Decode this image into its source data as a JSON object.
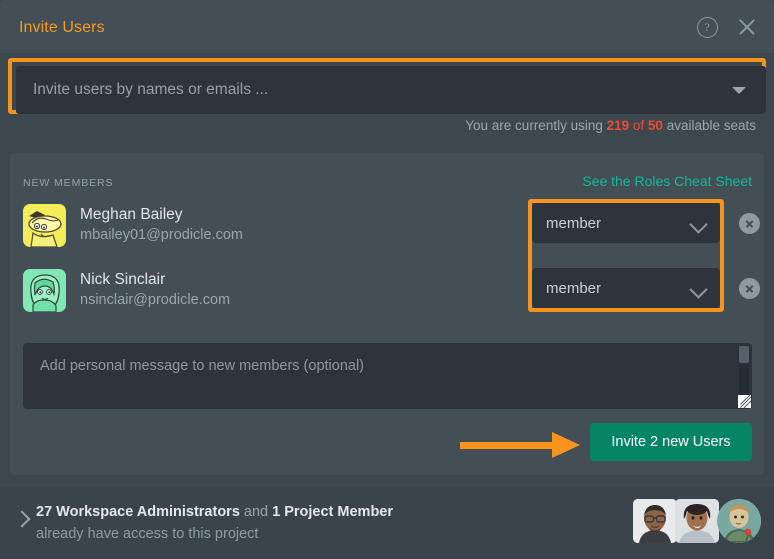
{
  "dialog": {
    "title": "Invite Users",
    "help_icon": "help-circle-icon",
    "close_icon": "close-icon"
  },
  "invite_field": {
    "placeholder": "Invite users by names or emails ...",
    "value": "",
    "caret_icon": "caret-down-icon",
    "highlight_color": "#f7941e"
  },
  "seats": {
    "prefix": "You are currently using ",
    "used": "219",
    "of": " of ",
    "total": "50",
    "suffix": " available seats",
    "warning_color": "#ef4a35"
  },
  "new_members": {
    "section_label": "NEW MEMBERS",
    "cheat_sheet_link": "See the Roles Cheat Sheet",
    "cheat_sheet_color": "#15b79b",
    "members": [
      {
        "name": "Meghan Bailey",
        "email": "mbailey01@prodicle.com",
        "avatar": "yellow-cartoon-avatar",
        "role": "member",
        "role_chevron_icon": "chevron-down-icon",
        "remove_icon": "remove-circle-x-icon"
      },
      {
        "name": "Nick Sinclair",
        "email": "nsinclair@prodicle.com",
        "avatar": "green-cartoon-avatar",
        "role": "member",
        "role_chevron_icon": "chevron-down-icon",
        "remove_icon": "remove-circle-x-icon"
      }
    ]
  },
  "message": {
    "placeholder": "Add personal message to new members (optional)",
    "value": "",
    "resize_handle_icon": "resize-grip-icon",
    "scrollbar": "vertical-scrollbar"
  },
  "actions": {
    "invite_button": "Invite 2 new Users",
    "invite_button_color": "#068466",
    "arrow_annotation_color": "#f7941e"
  },
  "footer": {
    "expand_icon": "chevron-right-icon",
    "admins_count": "27 Workspace Administrators",
    "conjunction": " and ",
    "members_count": "1 Project Member",
    "line2": "already have access to this project",
    "avatars": [
      "photo-avatar-man",
      "photo-avatar-woman",
      "illustrated-avatar-round"
    ]
  }
}
